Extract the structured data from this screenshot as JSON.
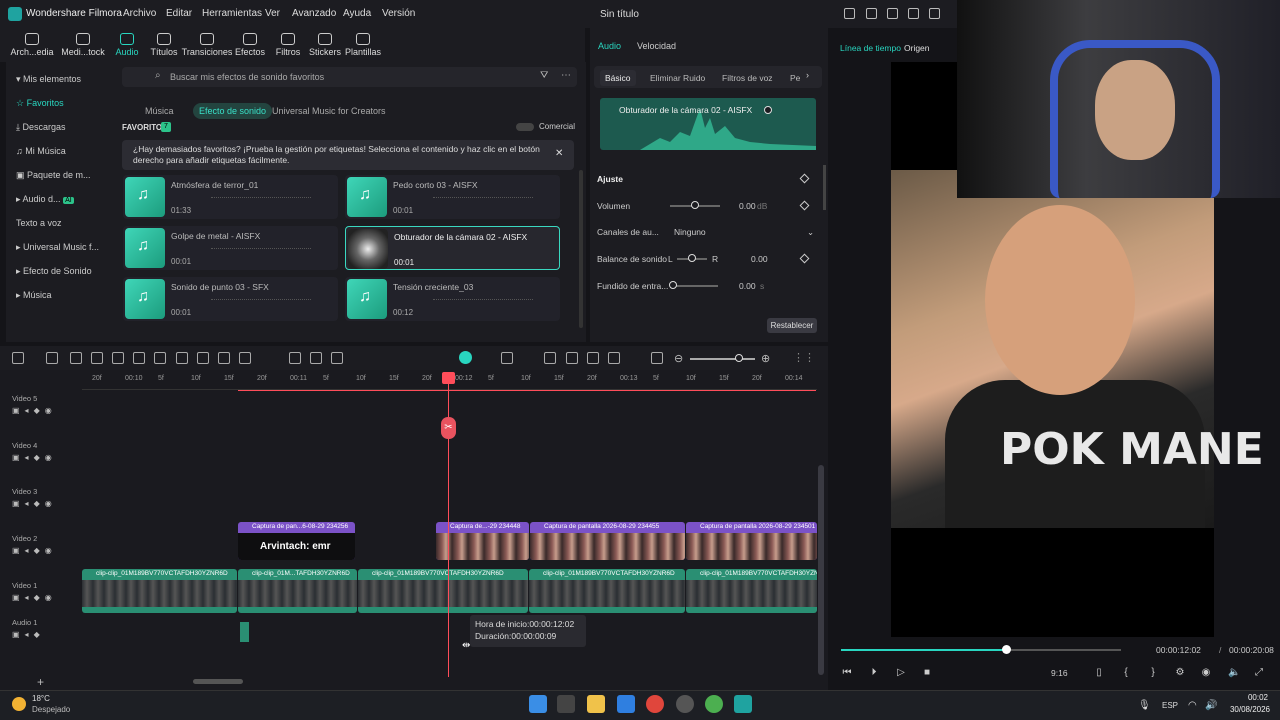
{
  "app": {
    "name": "Wondershare Filmora",
    "title": "Sin título"
  },
  "menu": [
    "Archivo",
    "Editar",
    "Herramientas",
    "Ver",
    "Avanzado",
    "Ayuda",
    "Versión"
  ],
  "toolbar": [
    {
      "label": "Arch...edia",
      "icon": "import-icon"
    },
    {
      "label": "Medi...tock",
      "icon": "stock-media-icon"
    },
    {
      "label": "Audio",
      "icon": "audio-icon"
    },
    {
      "label": "Títulos",
      "icon": "titles-icon"
    },
    {
      "label": "Transiciones",
      "icon": "transitions-icon"
    },
    {
      "label": "Efectos",
      "icon": "effects-icon"
    },
    {
      "label": "Filtros",
      "icon": "filters-icon"
    },
    {
      "label": "Stickers",
      "icon": "stickers-icon"
    },
    {
      "label": "Plantillas",
      "icon": "templates-icon"
    }
  ],
  "sidebar": {
    "items": [
      "Mis elementos",
      "Favoritos",
      "Descargas",
      "Mi Música",
      "Paquete de m...",
      "Audio d...",
      "Texto a voz",
      "Universal Music f...",
      "Efecto de Sonido",
      "Música"
    ],
    "ai_badge": "AI"
  },
  "search": {
    "placeholder": "Buscar mis efectos de sonido favoritos"
  },
  "subtabs": [
    "Música",
    "Efecto de sonido",
    "Universal Music for Creators"
  ],
  "favorites": {
    "label": "FAVORITOS",
    "count": "7",
    "commercial": "Comercial"
  },
  "tip": "¿Hay demasiados favoritos? ¡Prueba la gestión por etiquetas! Selecciona el contenido y haz clic en el botón derecho para añadir etiquetas fácilmente.",
  "cards": [
    {
      "name": "Atmósfera de terror_01",
      "dur": "01:33"
    },
    {
      "name": "Pedo corto 03 - AISFX",
      "dur": "00:01"
    },
    {
      "name": "Golpe de metal - AISFX",
      "dur": "00:01"
    },
    {
      "name": "Obturador de la cámara 02 - AISFX",
      "dur": "00:01"
    },
    {
      "name": "Sonido de punto 03 - SFX",
      "dur": "00:01"
    },
    {
      "name": "Tensión creciente_03",
      "dur": "00:12"
    }
  ],
  "props": {
    "tabs": [
      "Audio",
      "Velocidad"
    ],
    "subtabs": [
      "Básico",
      "Eliminar Ruido",
      "Filtros de voz",
      "Pe"
    ],
    "wave_label": "Obturador de la cámara 02 - AISFX",
    "ajuste": "Ajuste",
    "volumen": "Volumen",
    "vol_val": "0.00",
    "vol_unit": "dB",
    "vol_level": 0.5,
    "canales": "Canales de au...",
    "canales_val": "Ninguno",
    "balance": "Balance de sonido",
    "bal_l": "L",
    "bal_r": "R",
    "bal_val": "0.00",
    "fundido": "Fundido de entra...",
    "fund_val": "0.00",
    "fund_unit": "s",
    "reset": "Restablecer"
  },
  "player": {
    "tabs": [
      "Línea de tiempo",
      "Origen"
    ],
    "current": "00:00:12:02",
    "total": "00:00:20:08",
    "ratio": "9:16",
    "progress": 0.59,
    "shirt_text": "POK MANE"
  },
  "ruler": [
    "20f",
    "00:10",
    "5f",
    "10f",
    "15f",
    "20f",
    "00:11",
    "5f",
    "10f",
    "15f",
    "20f",
    "00:12",
    "5f",
    "10f",
    "15f",
    "20f",
    "00:13",
    "5f",
    "10f",
    "15f",
    "20f",
    "00:14"
  ],
  "tracks": [
    "Video 5",
    "Video 4",
    "Video 3",
    "Video 2",
    "Video 1",
    "Audio 1"
  ],
  "clips_v2": [
    "Captura de pan...6-08-29 234256",
    "Captura de...-29 234448",
    "Captura de pantalla 2026-08-29 234455",
    "Captura de pantalla 2026-08-29 234501"
  ],
  "clip_v2_text": "Arvintach: emr",
  "clips_v1": [
    "clip-clip_01M189BV770VCTAFDH30YZNR6D",
    "clip-clip_01M...TAFDH30YZNR6D",
    "clip-clip_01M189BV770VCTAFDH30YZNR6D",
    "clip-clip_01M189BV770VCTAFDH30YZNR6D",
    "clip-clip_01M189BV770VCTAFDH30YZNR6D"
  ],
  "tooltip": {
    "start": "Hora de inicio:00:00:12:02",
    "dur": "Duración:00:00:00:09"
  },
  "taskbar": {
    "temp": "18°C",
    "weather": "Despejado",
    "lang": "ESP",
    "time": "00:02",
    "date": "30/08/2026"
  }
}
